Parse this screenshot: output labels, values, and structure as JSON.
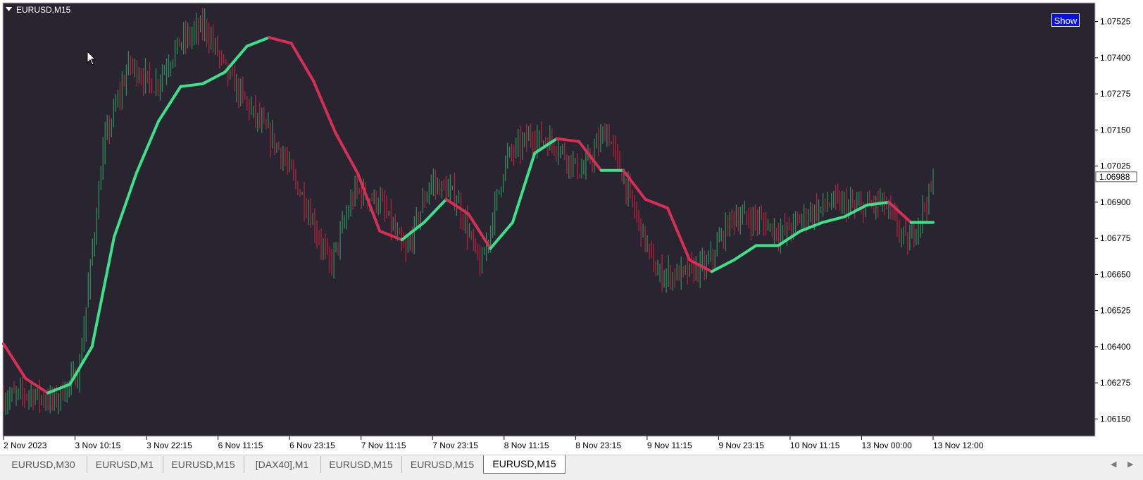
{
  "window": {
    "title": "EURUSD,M15"
  },
  "toolbar": {
    "show_label": "Show"
  },
  "price_axis": {
    "ticks": [
      "1.07525",
      "1.07400",
      "1.07275",
      "1.07150",
      "1.07025",
      "1.06900",
      "1.06775",
      "1.06650",
      "1.06525",
      "1.06400",
      "1.06275",
      "1.06150"
    ],
    "current_price": "1.06988"
  },
  "time_axis": {
    "labels": [
      "2 Nov 2023",
      "3 Nov 10:15",
      "3 Nov 22:15",
      "6 Nov 11:15",
      "6 Nov 23:15",
      "7 Nov 11:15",
      "7 Nov 23:15",
      "8 Nov 11:15",
      "8 Nov 23:15",
      "9 Nov 11:15",
      "9 Nov 23:15",
      "10 Nov 11:15",
      "13 Nov 00:00",
      "13 Nov 12:00"
    ]
  },
  "tabs": [
    {
      "label": "EURUSD,M30",
      "active": false
    },
    {
      "label": "EURUSD,M1",
      "active": false
    },
    {
      "label": "EURUSD,M15",
      "active": false
    },
    {
      "label": "[DAX40],M1",
      "active": false
    },
    {
      "label": "EURUSD,M15",
      "active": false
    },
    {
      "label": "EURUSD,M15",
      "active": false
    },
    {
      "label": "EURUSD,M15",
      "active": true
    }
  ],
  "colors": {
    "background": "#282430",
    "bull_bar": "#2e8b57",
    "bear_bar": "#b2223f",
    "trend_up": "#3ee08a",
    "trend_down": "#d62f55"
  },
  "chart_data": {
    "type": "line",
    "symbol": "EURUSD",
    "timeframe": "M15",
    "ylim": [
      1.0609,
      1.0759
    ],
    "x": [
      "2 Nov 2023",
      "3 Nov 10:15",
      "3 Nov 22:15",
      "6 Nov 11:15",
      "6 Nov 23:15",
      "7 Nov 11:15",
      "7 Nov 23:15",
      "8 Nov 11:15",
      "8 Nov 23:15",
      "9 Nov 11:15",
      "9 Nov 23:15",
      "10 Nov 11:15",
      "13 Nov 00:00",
      "13 Nov 12:00"
    ],
    "price_waypoints": [
      1.0622,
      1.0624,
      1.0621,
      1.0631,
      1.071,
      1.0738,
      1.073,
      1.0745,
      1.0751,
      1.0733,
      1.072,
      1.0708,
      1.069,
      1.0668,
      1.0694,
      1.069,
      1.0672,
      1.0697,
      1.0692,
      1.0667,
      1.0705,
      1.0713,
      1.071,
      1.07,
      1.0715,
      1.069,
      1.0665,
      1.0665,
      1.0668,
      1.0685,
      1.0684,
      1.0679,
      1.0686,
      1.069,
      1.0688,
      1.069,
      1.0675,
      1.0696
    ],
    "series": [
      {
        "style": "trend line, green when rising, red when falling",
        "values": [
          1.0641,
          1.0629,
          1.0624,
          1.0627,
          1.064,
          1.0678,
          1.07,
          1.0718,
          1.073,
          1.0731,
          1.0735,
          1.0744,
          1.0747,
          1.0745,
          1.0732,
          1.0714,
          1.07,
          1.068,
          1.0677,
          1.0683,
          1.0691,
          1.0686,
          1.0674,
          1.0683,
          1.0707,
          1.0712,
          1.0711,
          1.0701,
          1.0701,
          1.0691,
          1.0688,
          1.067,
          1.0666,
          1.067,
          1.0675,
          1.0675,
          1.068,
          1.0683,
          1.0685,
          1.0689,
          1.069,
          1.0683,
          1.0683
        ]
      }
    ]
  }
}
